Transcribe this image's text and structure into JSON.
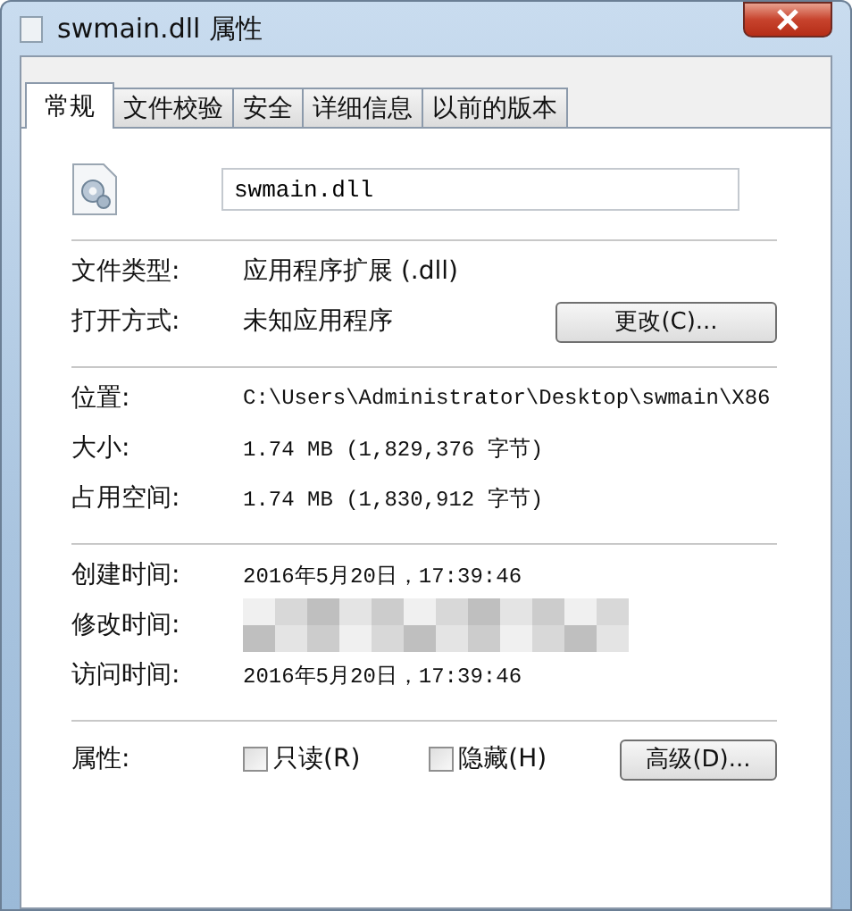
{
  "window": {
    "title": "swmain.dll 属性"
  },
  "tabs": [
    {
      "label": "常规",
      "selected": true
    },
    {
      "label": "文件校验",
      "selected": false
    },
    {
      "label": "安全",
      "selected": false
    },
    {
      "label": "详细信息",
      "selected": false
    },
    {
      "label": "以前的版本",
      "selected": false
    }
  ],
  "file_name": "swmain.dll",
  "groups": [
    {
      "rows": [
        {
          "kind": "text",
          "label": "文件类型:",
          "value": "应用程序扩展 (.dll)"
        },
        {
          "kind": "button",
          "label": "打开方式:",
          "value": "未知应用程序",
          "button": "更改(C)..."
        }
      ]
    },
    {
      "rows": [
        {
          "kind": "mono",
          "label": "位置:",
          "value": "C:\\Users\\Administrator\\Desktop\\swmain\\X86"
        },
        {
          "kind": "mono",
          "label": "大小:",
          "value": "1.74 MB (1,829,376 字节)"
        },
        {
          "kind": "mono",
          "label": "占用空间:",
          "value": "1.74 MB (1,830,912 字节)"
        }
      ]
    },
    {
      "rows": [
        {
          "kind": "mono",
          "label": "创建时间:",
          "value": "2016年5月20日，17:39:46"
        },
        {
          "kind": "redacted",
          "label": "修改时间:"
        },
        {
          "kind": "mono",
          "label": "访问时间:",
          "value": "2016年5月20日，17:39:46"
        }
      ]
    }
  ],
  "attributes": {
    "label": "属性:",
    "checkboxes": [
      {
        "label": "只读(R)",
        "checked": false
      },
      {
        "label": "隐藏(H)",
        "checked": false
      }
    ],
    "button": "高级(D)..."
  }
}
